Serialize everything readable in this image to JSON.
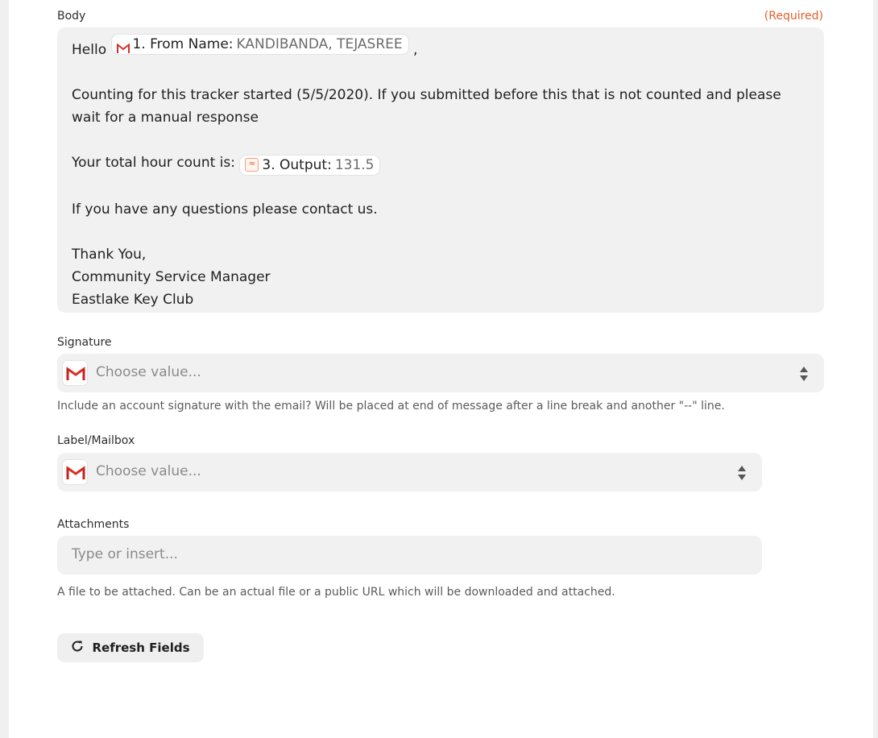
{
  "body_field": {
    "label": "Body",
    "required": "(Required)",
    "greeting": "Hello",
    "pill_from": {
      "icon": "gmail-icon",
      "label": "1. From Name:",
      "value": "KANDIBANDA, TEJASREE"
    },
    "after_greeting": ",",
    "line_counting": "Counting for this tracker started (5/5/2020). If you submitted before this that is not counted and please wait for a manual response",
    "hours_prefix": "Your total hour count is:",
    "pill_output": {
      "icon": "formatter-icon",
      "label": "3. Output:",
      "value": "131.5"
    },
    "line_questions": "If you have any questions please contact us.",
    "signoff_1": "Thank You,",
    "signoff_2": "Community Service Manager",
    "signoff_3": "Eastlake Key Club"
  },
  "signature_field": {
    "label": "Signature",
    "placeholder": "Choose value...",
    "help": "Include an account signature with the email? Will be placed at end of message after a line break and another \"--\" line."
  },
  "label_field": {
    "label": "Label/Mailbox",
    "placeholder": "Choose value..."
  },
  "attachments_field": {
    "label": "Attachments",
    "placeholder": "Type or insert...",
    "help": "A file to be attached. Can be an actual file or a public URL which will be downloaded and attached."
  },
  "refresh_button": {
    "label": "Refresh Fields",
    "icon": "refresh-icon"
  },
  "colors": {
    "accent_required": "#e0612b",
    "gmail_red": "#d93025",
    "field_bg": "#f1f1f1"
  }
}
